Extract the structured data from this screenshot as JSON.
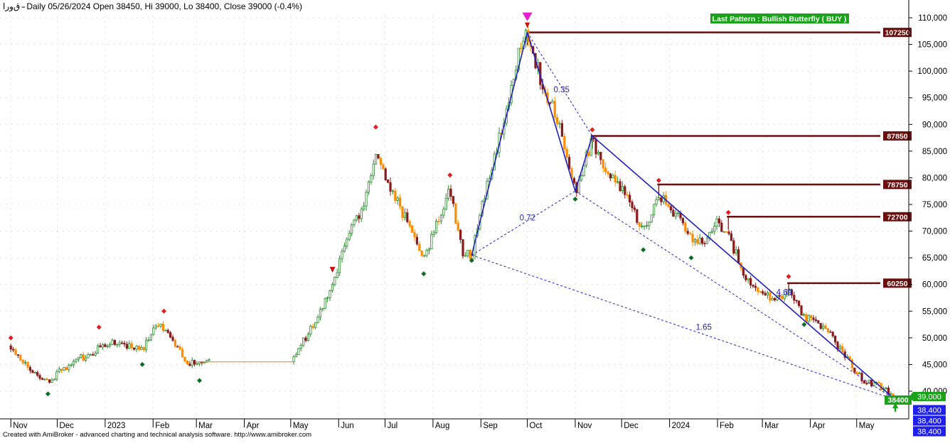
{
  "header": {
    "symbol": "ﻕﻭﺭﺍ -",
    "text": " - Daily 05/26/2024 Open 38450, Hi 39000, Lo 38400, Close 39000 (-0.4%)"
  },
  "footer": {
    "credit": "Created with AmiBroker - advanced charting and technical analysis software. http://www.amibroker.com"
  },
  "pattern_label": "Last Pattern : Bullish Butterfly ( BUY )",
  "colors": {
    "up": "#2e8b2e",
    "down": "#8b1a1a",
    "accent": "#ff8c00",
    "pattern": "#1f1fbf",
    "level": "#6b0f0f",
    "pattern_label_bg": "#1aa31a",
    "price_tag_green": "#1aa31a",
    "price_tag_blue": "#1f1ff0",
    "magenta": "#e61ecf"
  },
  "chart_data": {
    "type": "candlestick",
    "title": "",
    "x_ticks": [
      "Nov",
      "Dec",
      "2023",
      "Feb",
      "Mar",
      "Apr",
      "May",
      "Jun",
      "Jul",
      "Aug",
      "Sep",
      "Oct",
      "Nov",
      "Dec",
      "2024",
      "Feb",
      "Mar",
      "Apr",
      "May"
    ],
    "y_range": [
      35000,
      113000
    ],
    "y_ticks": [
      {
        "v": 110000,
        "label": "110,000"
      },
      {
        "v": 105000,
        "label": "105,000"
      },
      {
        "v": 100000,
        "label": "100,000"
      },
      {
        "v": 95000,
        "label": "95,000"
      },
      {
        "v": 90000,
        "label": "90,000"
      },
      {
        "v": 85000,
        "label": "85,000"
      },
      {
        "v": 80000,
        "label": "80,000"
      },
      {
        "v": 75000,
        "label": "75,000"
      },
      {
        "v": 70000,
        "label": "70,000"
      },
      {
        "v": 65000,
        "label": "65,000"
      },
      {
        "v": 60000,
        "label": "60,000"
      },
      {
        "v": 55000,
        "label": "55,000"
      },
      {
        "v": 50000,
        "label": "50,000"
      },
      {
        "v": 45000,
        "label": "45,000"
      },
      {
        "v": 40000,
        "label": "40,000"
      }
    ],
    "price_path": [
      [
        "2022-11-01",
        48500
      ],
      [
        "2022-11-12",
        44500
      ],
      [
        "2022-11-25",
        41500
      ],
      [
        "2022-12-02",
        43500
      ],
      [
        "2022-12-15",
        46000
      ],
      [
        "2022-12-28",
        48000
      ],
      [
        "2023-01-05",
        49500
      ],
      [
        "2023-01-25",
        47500
      ],
      [
        "2023-02-03",
        53000
      ],
      [
        "2023-02-12",
        50000
      ],
      [
        "2023-02-24",
        45000
      ],
      [
        "2023-03-03",
        46000
      ],
      [
        "2023-03-15",
        45500
      ],
      [
        "2023-04-15",
        45500
      ],
      [
        "2023-05-02",
        45500
      ],
      [
        "2023-05-18",
        54000
      ],
      [
        "2023-05-28",
        60000
      ],
      [
        "2023-06-06",
        69000
      ],
      [
        "2023-06-15",
        73000
      ],
      [
        "2023-06-25",
        85000
      ],
      [
        "2023-07-06",
        77000
      ],
      [
        "2023-07-18",
        70000
      ],
      [
        "2023-07-26",
        64500
      ],
      [
        "2023-08-05",
        73000
      ],
      [
        "2023-08-12",
        78000
      ],
      [
        "2023-08-20",
        66000
      ],
      [
        "2023-08-26",
        65500
      ],
      [
        "2023-09-06",
        80000
      ],
      [
        "2023-09-18",
        93000
      ],
      [
        "2023-09-26",
        104000
      ],
      [
        "2023-10-01",
        107000
      ],
      [
        "2023-10-10",
        98000
      ],
      [
        "2023-10-22",
        90000
      ],
      [
        "2023-11-01",
        77500
      ],
      [
        "2023-11-12",
        87000
      ],
      [
        "2023-11-22",
        81000
      ],
      [
        "2023-12-05",
        76000
      ],
      [
        "2023-12-15",
        70000
      ],
      [
        "2023-12-25",
        77000
      ],
      [
        "2024-01-05",
        73000
      ],
      [
        "2024-01-15",
        69000
      ],
      [
        "2024-01-25",
        68000
      ],
      [
        "2024-02-01",
        72000
      ],
      [
        "2024-02-08",
        69000
      ],
      [
        "2024-02-20",
        61000
      ],
      [
        "2024-03-01",
        58000
      ],
      [
        "2024-03-12",
        57000
      ],
      [
        "2024-03-18",
        59000
      ],
      [
        "2024-03-28",
        54000
      ],
      [
        "2024-04-10",
        52000
      ],
      [
        "2024-04-25",
        46000
      ],
      [
        "2024-05-05",
        42000
      ],
      [
        "2024-05-15",
        41000
      ],
      [
        "2024-05-26",
        39000
      ]
    ],
    "pivot_highs": [
      [
        "2022-11-01",
        50000
      ],
      [
        "2022-12-28",
        52000
      ],
      [
        "2023-02-08",
        55000
      ],
      [
        "2023-06-25",
        89500
      ],
      [
        "2023-08-12",
        80500
      ],
      [
        "2023-11-12",
        89000
      ],
      [
        "2023-12-25",
        79500
      ],
      [
        "2024-02-08",
        73500
      ],
      [
        "2024-03-18",
        61500
      ]
    ],
    "pivot_lows": [
      [
        "2022-11-25",
        39500
      ],
      [
        "2023-01-25",
        45000
      ],
      [
        "2023-03-03",
        42000
      ],
      [
        "2023-07-26",
        62000
      ],
      [
        "2023-08-26",
        64500
      ],
      [
        "2023-11-01",
        76000
      ],
      [
        "2023-12-15",
        66500
      ],
      [
        "2024-01-15",
        65000
      ],
      [
        "2024-03-28",
        52500
      ]
    ],
    "pattern": {
      "name": "Bullish Butterfly",
      "X": [
        "2023-08-26",
        65500
      ],
      "A": [
        "2023-10-01",
        107250
      ],
      "B": [
        "2023-11-01",
        77500
      ],
      "C": [
        "2023-11-12",
        87850
      ],
      "D": [
        "2024-05-26",
        38400
      ],
      "ratios": [
        {
          "label": "0.35",
          "at": [
            "2023-10-18",
            96000
          ]
        },
        {
          "label": "0.72",
          "at": [
            "2023-09-26",
            72000
          ]
        },
        {
          "label": "4.69",
          "at": [
            "2024-03-10",
            58000
          ]
        },
        {
          "label": "1.65",
          "at": [
            "2024-01-18",
            51500
          ]
        }
      ]
    },
    "levels": [
      {
        "value": 107250,
        "label": "107250",
        "from": "2023-10-01"
      },
      {
        "value": 87850,
        "label": "87850",
        "from": "2023-11-12"
      },
      {
        "value": 78750,
        "label": "78750",
        "from": "2023-12-25"
      },
      {
        "value": 72700,
        "label": "72700",
        "from": "2024-02-08"
      },
      {
        "value": 60250,
        "label": "60250",
        "from": "2024-03-18"
      }
    ],
    "last_prices": [
      {
        "value": 39000,
        "label": "39,000",
        "style": "green"
      },
      {
        "value": 38400,
        "label": "38,400",
        "style": "blue"
      },
      {
        "value": 38400,
        "label": "38,400",
        "style": "blue"
      },
      {
        "value": 38400,
        "label": "38,400",
        "style": "blue"
      }
    ],
    "d_label": "38400"
  }
}
